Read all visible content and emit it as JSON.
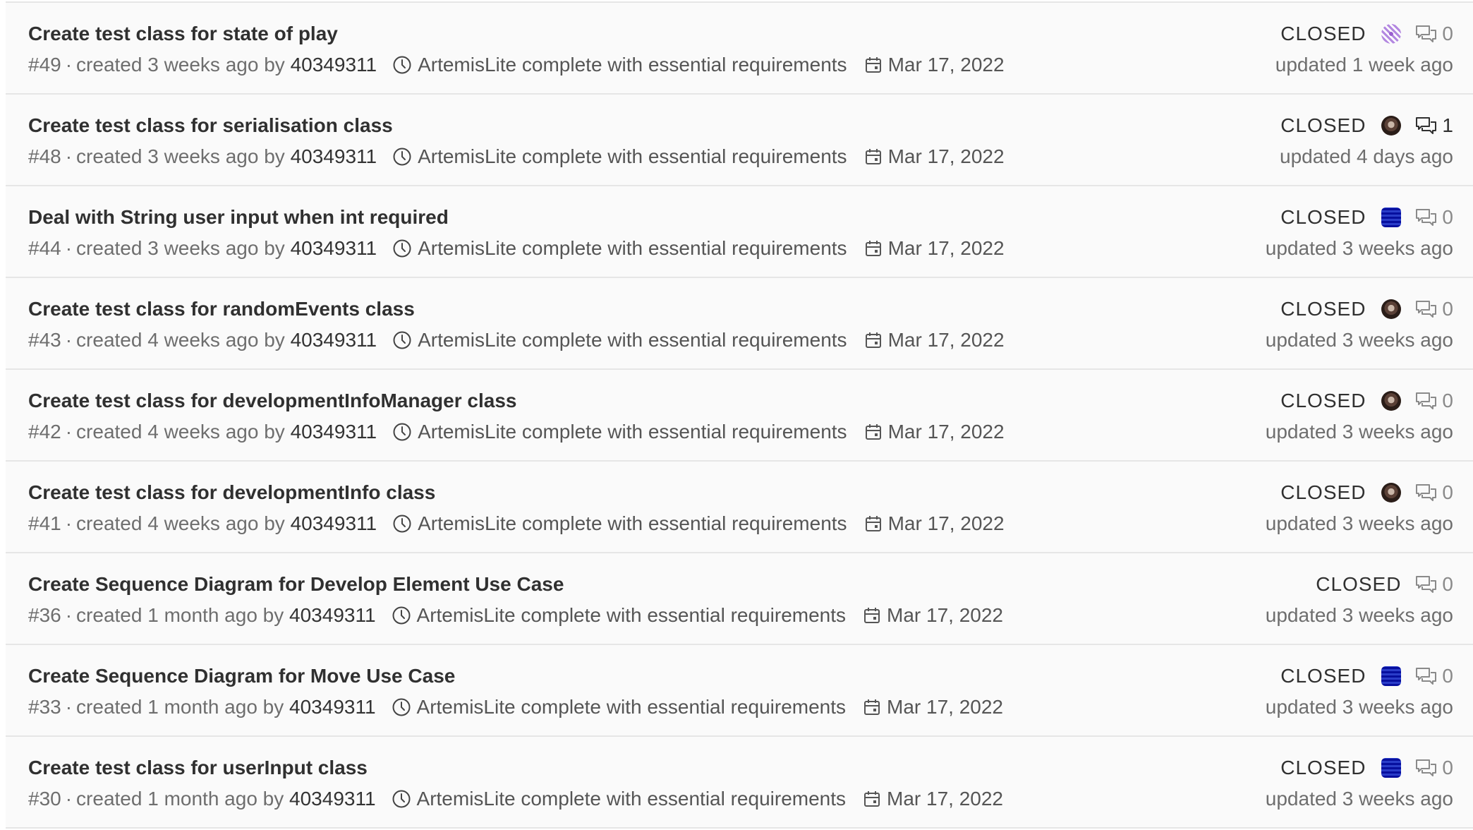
{
  "issues": [
    {
      "title": "Create test class for state of play",
      "number": "#49",
      "created_text": "created 3 weeks ago by",
      "author": "40349311",
      "milestone": "ArtemisLite complete with essential requirements",
      "due_date": "Mar 17, 2022",
      "state": "CLOSED",
      "avatar": "purple-pattern-avatar",
      "comments": "0",
      "updated": "updated 1 week ago"
    },
    {
      "title": "Create test class for serialisation class",
      "number": "#48",
      "created_text": "created 3 weeks ago by",
      "author": "40349311",
      "milestone": "ArtemisLite complete with essential requirements",
      "due_date": "Mar 17, 2022",
      "state": "CLOSED",
      "avatar": "photo-avatar",
      "comments": "1",
      "updated": "updated 4 days ago"
    },
    {
      "title": "Deal with String user input when int required",
      "number": "#44",
      "created_text": "created 3 weeks ago by",
      "author": "40349311",
      "milestone": "ArtemisLite complete with essential requirements",
      "due_date": "Mar 17, 2022",
      "state": "CLOSED",
      "avatar": "blue-pattern-avatar",
      "comments": "0",
      "updated": "updated 3 weeks ago"
    },
    {
      "title": "Create test class for randomEvents class",
      "number": "#43",
      "created_text": "created 4 weeks ago by",
      "author": "40349311",
      "milestone": "ArtemisLite complete with essential requirements",
      "due_date": "Mar 17, 2022",
      "state": "CLOSED",
      "avatar": "photo-avatar",
      "comments": "0",
      "updated": "updated 3 weeks ago"
    },
    {
      "title": "Create test class for developmentInfoManager class",
      "number": "#42",
      "created_text": "created 4 weeks ago by",
      "author": "40349311",
      "milestone": "ArtemisLite complete with essential requirements",
      "due_date": "Mar 17, 2022",
      "state": "CLOSED",
      "avatar": "photo-avatar",
      "comments": "0",
      "updated": "updated 3 weeks ago"
    },
    {
      "title": "Create test class for developmentInfo class",
      "number": "#41",
      "created_text": "created 4 weeks ago by",
      "author": "40349311",
      "milestone": "ArtemisLite complete with essential requirements",
      "due_date": "Mar 17, 2022",
      "state": "CLOSED",
      "avatar": "photo-avatar",
      "comments": "0",
      "updated": "updated 3 weeks ago"
    },
    {
      "title": "Create Sequence Diagram for Develop Element Use Case",
      "number": "#36",
      "created_text": "created 1 month ago by",
      "author": "40349311",
      "milestone": "ArtemisLite complete with essential requirements",
      "due_date": "Mar 17, 2022",
      "state": "CLOSED",
      "avatar": "",
      "comments": "0",
      "updated": "updated 3 weeks ago"
    },
    {
      "title": "Create Sequence Diagram for Move Use Case",
      "number": "#33",
      "created_text": "created 1 month ago by",
      "author": "40349311",
      "milestone": "ArtemisLite complete with essential requirements",
      "due_date": "Mar 17, 2022",
      "state": "CLOSED",
      "avatar": "blue-pattern-avatar",
      "comments": "0",
      "updated": "updated 3 weeks ago"
    },
    {
      "title": "Create test class for userInput class",
      "number": "#30",
      "created_text": "created 1 month ago by",
      "author": "40349311",
      "milestone": "ArtemisLite complete with essential requirements",
      "due_date": "Mar 17, 2022",
      "state": "CLOSED",
      "avatar": "blue-pattern-avatar",
      "comments": "0",
      "updated": "updated 3 weeks ago"
    }
  ],
  "icons": {
    "milestone": "clock-icon",
    "due_date": "calendar-icon",
    "comments": "comment-icon"
  }
}
